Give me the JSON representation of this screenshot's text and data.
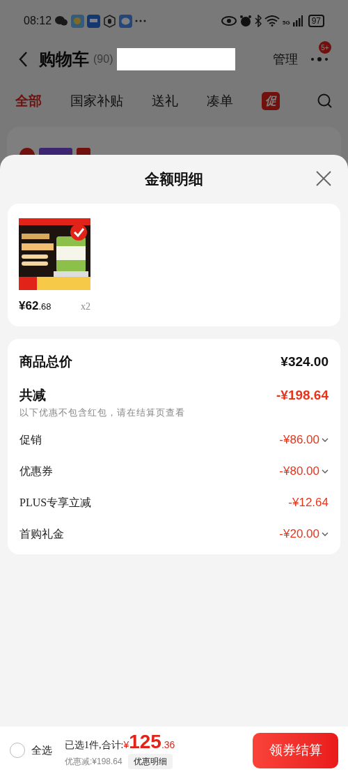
{
  "status_bar": {
    "time": "08:12",
    "network": "5G",
    "battery": "97"
  },
  "header": {
    "title": "购物车",
    "count": "(90)",
    "manage": "管理",
    "badge": "5+"
  },
  "tabs": [
    {
      "label": "全部",
      "selected": true,
      "kind": "text"
    },
    {
      "label": "国家补贴",
      "selected": false,
      "kind": "text"
    },
    {
      "label": "送礼",
      "selected": false,
      "kind": "text"
    },
    {
      "label": "凑单",
      "selected": false,
      "kind": "text"
    },
    {
      "label": "促",
      "selected": false,
      "kind": "badge"
    }
  ],
  "store": {
    "checked": true
  },
  "sheet": {
    "title": "金额明细",
    "items": [
      {
        "kind": "picture",
        "price": "¥62",
        "price_decimal": ".68",
        "quantity": "x2"
      }
    ],
    "summary": [
      {
        "kind": "total",
        "label": "商品总价",
        "value": "¥324.00"
      },
      {
        "kind": "discount_total",
        "label": "共减",
        "value": "-¥198.64",
        "note": "以下优惠不包含红包，请在结算页查看"
      },
      {
        "kind": "discount",
        "label": "促销",
        "value": "-¥86.00",
        "expandable": true
      },
      {
        "kind": "discount",
        "label": "优惠券",
        "value": "-¥80.00",
        "expandable": true
      },
      {
        "kind": "discount",
        "label": "PLUS专享立减",
        "value": "-¥12.64",
        "expandable": false
      },
      {
        "kind": "discount",
        "label": "首购礼金",
        "value": "-¥20.00",
        "expandable": true
      }
    ]
  },
  "footer": {
    "select_all": {
      "label": "全选",
      "checked": false
    },
    "selected_text": "已选1件,合计:",
    "currency": "¥",
    "total": "125",
    "total_decimal": ".36",
    "savings": "优惠减:¥198.64",
    "details": "优惠明细",
    "checkout": "领券结算"
  }
}
